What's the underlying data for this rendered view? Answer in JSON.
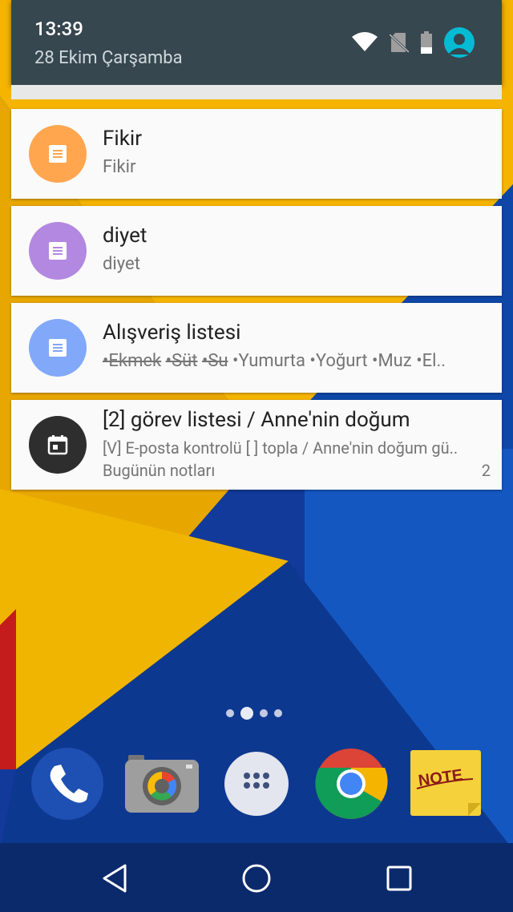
{
  "status": {
    "time": "13:39",
    "date": "28 Ekim Çarşamba"
  },
  "notifications": [
    {
      "title": "Fikir",
      "text": "Fikir",
      "icon": "note-icon",
      "color": "#ffa64f"
    },
    {
      "title": "diyet",
      "text": "diyet",
      "icon": "note-icon",
      "color": "#b388e0"
    },
    {
      "title": "Alışveriş listesi",
      "items_struck": [
        "•Ekmek",
        "•Süt",
        "•Su"
      ],
      "items_open": [
        "•Yumurta",
        "•Yoğurt",
        "•Muz",
        "•El.."
      ],
      "icon": "note-icon",
      "color": "#82a8f9"
    },
    {
      "title": "[2] görev listesi / Anne'nin doğum",
      "text": "[V] E-posta kontrolü [ ] topla / Anne'nin doğum gü..",
      "footer": "Bugünün notları",
      "count": "2",
      "icon": "calendar-icon",
      "color": "#2e2e2e"
    }
  ],
  "dock": {
    "note_label": "NOTE"
  },
  "colors": {
    "shade": "#37474f",
    "accent": "#03bcd4"
  }
}
